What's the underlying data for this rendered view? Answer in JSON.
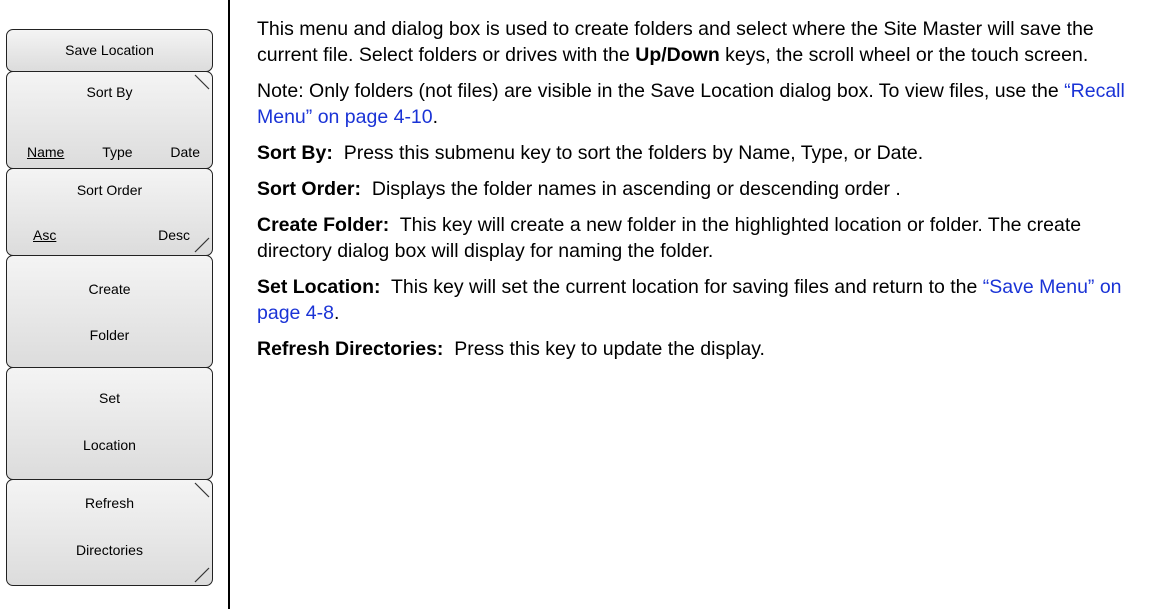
{
  "menu": {
    "title": "Save Location",
    "sort_by": {
      "label": "Sort By",
      "options": [
        "Name",
        "Type",
        "Date"
      ],
      "selected": "Name"
    },
    "sort_order": {
      "label": "Sort Order",
      "options": [
        "Asc",
        "Desc"
      ],
      "selected": "Asc"
    },
    "create_folder": {
      "line1": "Create",
      "line2": "Folder"
    },
    "set_location": {
      "line1": "Set",
      "line2": "Location"
    },
    "refresh": {
      "line1": "Refresh",
      "line2": "Directories"
    }
  },
  "content": {
    "intro": {
      "text1": "This menu and dialog box is used to create folders and select where the Site Master will save the current file. Select folders or drives with the ",
      "bold": "Up/Down",
      "text2": " keys, the scroll wheel or the touch screen."
    },
    "note": {
      "text1": "Note: Only folders (not files) are visible in the Save Location dialog box. To view files, use the ",
      "link": "“Recall Menu” on page 4-10",
      "text2": "."
    },
    "sort_by": {
      "term": "Sort By:",
      "desc": "Press this submenu key to sort the folders by Name, Type, or Date."
    },
    "sort_order": {
      "term": "Sort Order:",
      "desc": "Displays the folder names in ascending or descending order ."
    },
    "create_folder": {
      "term": "Create Folder:",
      "desc": "This key will create a new folder in the highlighted location or folder. The create directory dialog box will display for naming the folder."
    },
    "set_location": {
      "term": "Set Location:",
      "desc": "This key will set the current location for saving files and return to the ",
      "link": "“Save Menu” on page 4-8",
      "end": "."
    },
    "refresh": {
      "term": "Refresh Directories:",
      "desc": "Press this key to update the display."
    }
  }
}
